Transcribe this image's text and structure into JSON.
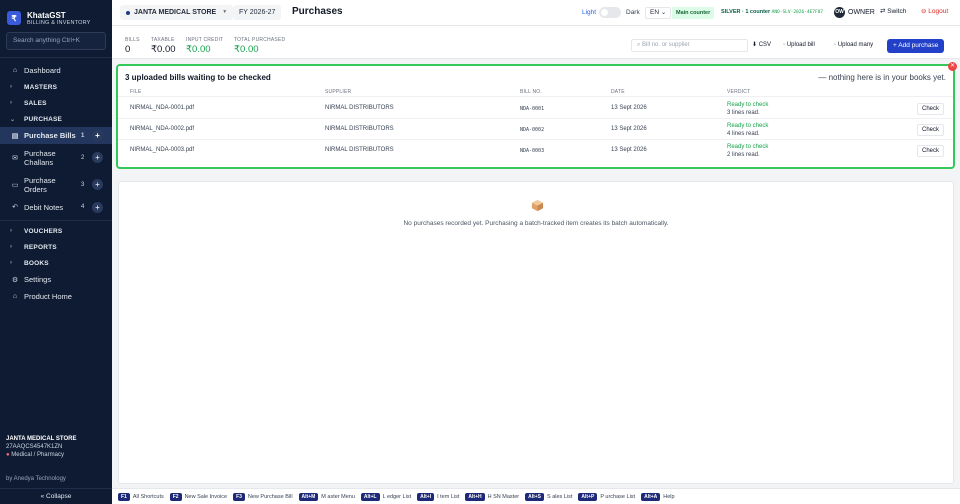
{
  "brand": {
    "logo_glyph": "₹",
    "name": "KhataGST",
    "subtitle": "BILLING & INVENTORY"
  },
  "sidebar": {
    "search_placeholder": "Search anything  Ctrl+K",
    "dashboard": "Dashboard",
    "groups": {
      "masters": "MASTERS",
      "sales": "SALES",
      "purchase": "PURCHASE",
      "vouchers": "VOUCHERS",
      "reports": "REPORTS",
      "books": "BOOKS"
    },
    "purchase_items": [
      {
        "label": "Purchase Bills",
        "count": "1",
        "icon": "file-icon"
      },
      {
        "label": "Purchase Challans",
        "count": "2",
        "icon": "mail-icon"
      },
      {
        "label": "Purchase Orders",
        "count": "3",
        "icon": "doc-icon"
      },
      {
        "label": "Debit Notes",
        "count": "4",
        "icon": "undo-icon"
      }
    ],
    "settings": "Settings",
    "product_home": "Product Home",
    "store_name": "JANTA MEDICAL STORE",
    "store_gst": "27AAQCS4547K1ZN",
    "store_type": "Medical / Pharmacy",
    "by_line": "by Anedya Technology",
    "collapse": "« Collapse"
  },
  "topbar": {
    "store": "JANTA MEDICAL STORE",
    "fy": "FY 2026-27",
    "title": "Purchases",
    "light": "Light",
    "dark": "Dark",
    "lang": "EN",
    "counter": "Main counter",
    "plan": "SILVER · 1 counter",
    "plan_key": "ANO-SLV-2026-4E7F87",
    "owner_initials": "OW",
    "owner": "OWNER",
    "switch": "⇄ Switch",
    "logout": "⊖ Logout"
  },
  "stats": [
    {
      "label": "BILLS",
      "value": "0"
    },
    {
      "label": "TAXABLE",
      "value": "₹0.00"
    },
    {
      "label": "INPUT CREDIT",
      "value": "₹0.00"
    },
    {
      "label": "TOTAL PURCHASED",
      "value": "₹0.00"
    }
  ],
  "toolbar": {
    "search_placeholder": "Bill no. or supplier",
    "csv": "⬇ CSV",
    "upload_bill": "Upload bill",
    "upload_many": "Upload many",
    "add": "+ Add purchase"
  },
  "uploads": {
    "title": "3 uploaded bills waiting to be checked",
    "empty_note": "— nothing here is in your books yet.",
    "headers": {
      "file": "FILE",
      "supplier": "SUPPLIER",
      "bill_no": "BILL NO.",
      "date": "DATE",
      "verdict": "VERDICT"
    },
    "rows": [
      {
        "file": "NIRMAL_NDA-0001.pdf",
        "supplier": "NIRMAL DISTRIBUTORS",
        "bill_no": "NDA-0001",
        "date": "13 Sept 2026",
        "verdict": "Ready to check",
        "lines": "3 lines read.",
        "action": "Check"
      },
      {
        "file": "NIRMAL_NDA-0002.pdf",
        "supplier": "NIRMAL DISTRIBUTORS",
        "bill_no": "NDA-0002",
        "date": "13 Sept 2026",
        "verdict": "Ready to check",
        "lines": "4 lines read.",
        "action": "Check"
      },
      {
        "file": "NIRMAL_NDA-0003.pdf",
        "supplier": "NIRMAL DISTRIBUTORS",
        "bill_no": "NDA-0003",
        "date": "13 Sept 2026",
        "verdict": "Ready to check",
        "lines": "2 lines read.",
        "action": "Check"
      }
    ]
  },
  "empty_state": {
    "icon": "box-icon",
    "message": "No purchases recorded yet. Purchasing a batch-tracked item creates its batch automatically."
  },
  "shortcuts": [
    {
      "key": "F1",
      "label": "All Shortcuts"
    },
    {
      "key": "F2",
      "label": "New Sale Invoice"
    },
    {
      "key": "F3",
      "label": "New Purchase Bill"
    },
    {
      "key": "Alt+M",
      "label": "M aster Menu"
    },
    {
      "key": "Alt+L",
      "label": "L edger List"
    },
    {
      "key": "Alt+I",
      "label": "I tem List"
    },
    {
      "key": "Alt+H",
      "label": "H SN Master"
    },
    {
      "key": "Alt+S",
      "label": "S ales List"
    },
    {
      "key": "Alt+P",
      "label": "P urchase List"
    },
    {
      "key": "Alt+A",
      "label": "Help"
    }
  ],
  "colors": {
    "sidebar_bg": "#0f1b33",
    "accent": "#2341c8",
    "highlight_border": "#34c759",
    "ready": "#16a34a",
    "danger": "#dc2626"
  }
}
